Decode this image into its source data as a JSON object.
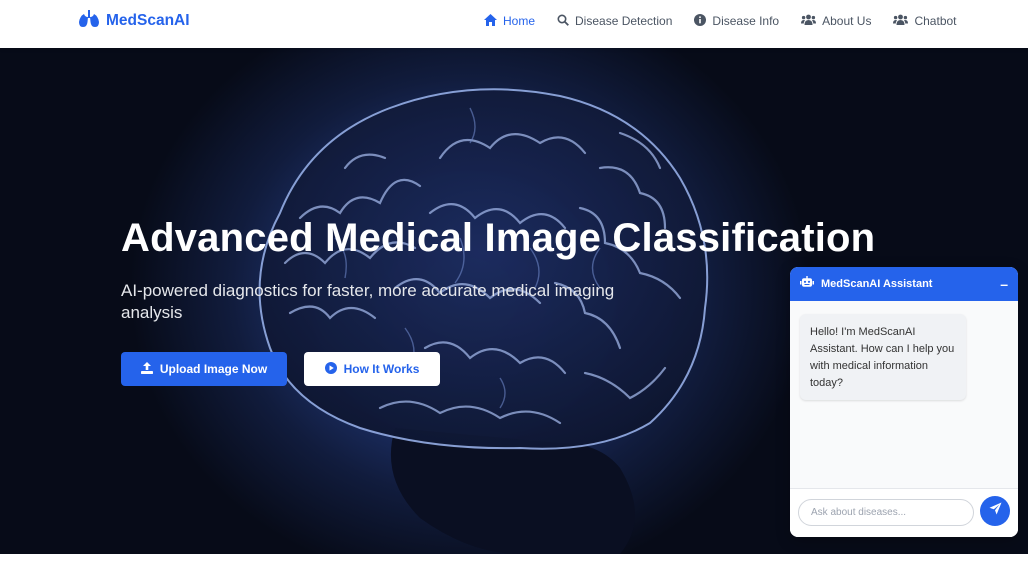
{
  "brand": {
    "name": "MedScanAI",
    "icon": "lungs-icon",
    "color": "#2563eb"
  },
  "nav": {
    "items": [
      {
        "label": "Home",
        "icon": "home-icon",
        "active": true
      },
      {
        "label": "Disease Detection",
        "icon": "search-icon"
      },
      {
        "label": "Disease Info",
        "icon": "info-icon"
      },
      {
        "label": "About Us",
        "icon": "users-icon"
      },
      {
        "label": "Chatbot",
        "icon": "users-icon"
      }
    ]
  },
  "hero": {
    "title": "Advanced Medical Image Classification",
    "subtitle": "AI-powered diagnostics for faster, more accurate medical imaging analysis",
    "primary_button": {
      "label": "Upload Image Now",
      "icon": "upload-icon"
    },
    "secondary_button": {
      "label": "How It Works",
      "icon": "play-circle-icon"
    }
  },
  "chat": {
    "title": "MedScanAI Assistant",
    "header_icon": "robot-icon",
    "minimize_label": "–",
    "messages": [
      {
        "from": "bot",
        "text": "Hello! I'm MedScanAI Assistant. How can I help you with medical information today?"
      }
    ],
    "input_placeholder": "Ask about diseases...",
    "send_icon": "paper-plane-icon"
  },
  "colors": {
    "primary": "#2563eb",
    "nav_text": "#4b5563",
    "hero_dark": "#0b1226"
  }
}
